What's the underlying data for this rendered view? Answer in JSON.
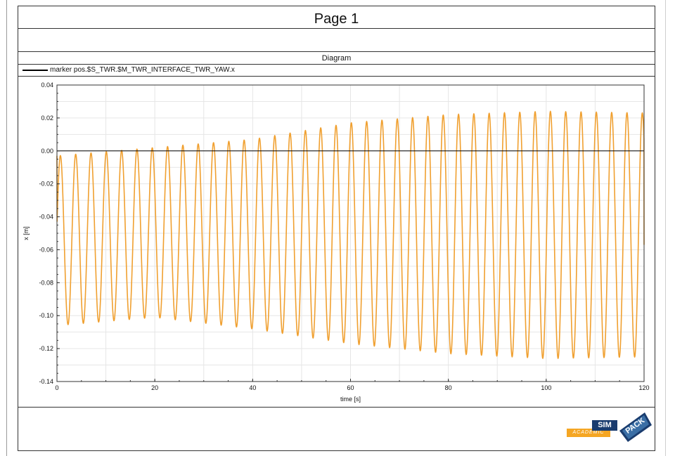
{
  "page": {
    "title": "Page 1",
    "diagram_title": "Diagram"
  },
  "legend": {
    "label": "marker pos.$S_TWR.$M_TWR_INTERFACE_TWR_YAW.x"
  },
  "logo": {
    "sim": "SIM",
    "pack": "PACK",
    "academic": "ACADEMIC"
  },
  "colors": {
    "series": "#f0a030",
    "zero_line": "#000000",
    "grid": "#e6e6e6"
  },
  "chart_data": {
    "type": "line",
    "title": "Diagram",
    "xlabel": "time [s]",
    "ylabel": "x [m]",
    "xlim": [
      0,
      120
    ],
    "ylim": [
      -0.14,
      0.04
    ],
    "x_ticks": [
      0,
      20,
      40,
      60,
      80,
      100,
      120
    ],
    "x_tick_labels": [
      "0",
      "20",
      "40",
      "60",
      "80",
      "100",
      "120"
    ],
    "y_ticks": [
      -0.14,
      -0.12,
      -0.1,
      -0.08,
      -0.06,
      -0.04,
      -0.02,
      0.0,
      0.02,
      0.04
    ],
    "y_tick_labels": [
      "-0.14",
      "-0.12",
      "-0.10",
      "-0.08",
      "-0.06",
      "-0.04",
      "-0.02",
      "0.00",
      "0.02",
      "0.04"
    ],
    "grid": true,
    "legend_position": "top-left",
    "series": [
      {
        "name": "marker pos.$S_TWR.$M_TWR_INTERFACE_TWR_YAW.x",
        "signal": "oscillation",
        "period": 3.13,
        "cycles": 38,
        "first_peak_time": 0.7,
        "upper_envelope": [
          {
            "x": 0,
            "y": -0.003
          },
          {
            "x": 20,
            "y": 0.002
          },
          {
            "x": 40,
            "y": 0.007
          },
          {
            "x": 60,
            "y": 0.017
          },
          {
            "x": 80,
            "y": 0.022
          },
          {
            "x": 100,
            "y": 0.024
          },
          {
            "x": 120,
            "y": 0.023
          }
        ],
        "lower_envelope": [
          {
            "x": 0,
            "y": -0.106
          },
          {
            "x": 20,
            "y": -0.101
          },
          {
            "x": 40,
            "y": -0.108
          },
          {
            "x": 60,
            "y": -0.117
          },
          {
            "x": 80,
            "y": -0.123
          },
          {
            "x": 100,
            "y": -0.126
          },
          {
            "x": 120,
            "y": -0.125
          }
        ],
        "end_value": -0.057
      },
      {
        "name": "",
        "signal": "constant",
        "value": 0.0
      }
    ]
  }
}
